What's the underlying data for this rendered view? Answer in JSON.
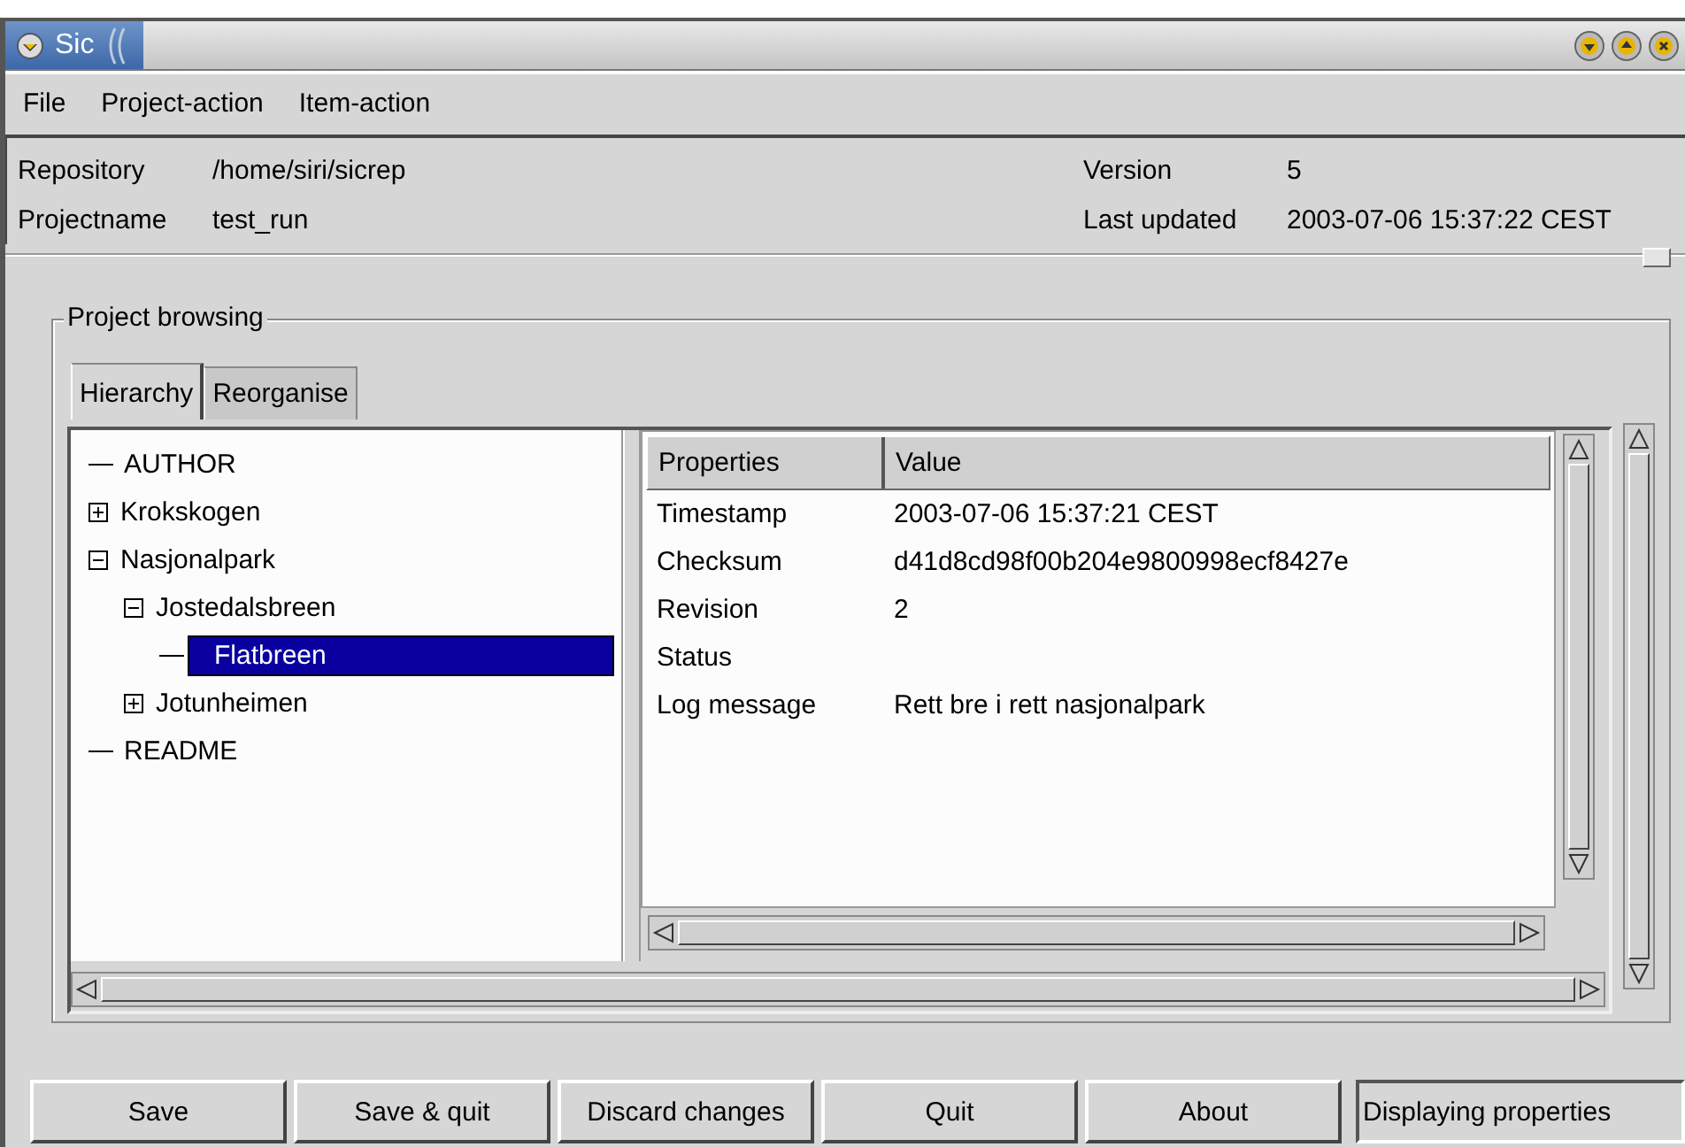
{
  "window": {
    "title": "Sic"
  },
  "menu": [
    {
      "label": "File"
    },
    {
      "label": "Project-action"
    },
    {
      "label": "Item-action"
    }
  ],
  "info": {
    "left": [
      {
        "label": "Repository",
        "value": "/home/siri/sicrep"
      },
      {
        "label": "Projectname",
        "value": "test_run"
      }
    ],
    "right": [
      {
        "label": "Version",
        "value": "5"
      },
      {
        "label": "Last updated",
        "value": "2003-07-06 15:37:22 CEST"
      }
    ]
  },
  "group": {
    "title": "Project browsing"
  },
  "tabs": [
    {
      "label": "Hierarchy",
      "selected": true
    },
    {
      "label": "Reorganise",
      "selected": false
    }
  ],
  "tree": [
    {
      "label": "AUTHOR",
      "selected": false
    },
    {
      "label": "Krokskogen",
      "expanded": false,
      "selected": false
    },
    {
      "label": "Nasjonalpark",
      "expanded": true,
      "selected": false,
      "children": [
        {
          "label": "Jostedalsbreen",
          "expanded": true,
          "selected": false,
          "children": [
            {
              "label": "Flatbreen",
              "selected": true
            }
          ]
        },
        {
          "label": "Jotunheimen",
          "expanded": false,
          "selected": false
        }
      ]
    },
    {
      "label": "README",
      "selected": false
    }
  ],
  "table": {
    "columns": [
      "Properties",
      "Value"
    ],
    "rows": [
      [
        "Timestamp",
        "2003-07-06 15:37:21 CEST"
      ],
      [
        "Checksum",
        "d41d8cd98f00b204e9800998ecf8427e"
      ],
      [
        "Revision",
        "2"
      ],
      [
        "Status",
        ""
      ],
      [
        "Log message",
        "Rett bre i rett nasjonalpark"
      ]
    ]
  },
  "buttons": [
    "Save",
    "Save & quit",
    "Discard changes",
    "Quit",
    "About"
  ],
  "status": "Displaying properties"
}
